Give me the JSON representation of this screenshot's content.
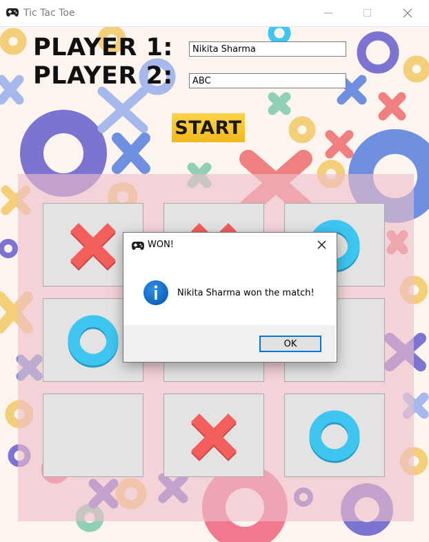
{
  "window": {
    "title": "Tic Tac Toe",
    "app_icon": "gamepad-icon",
    "controls": [
      "minimize-icon",
      "maximize-icon",
      "close-icon"
    ]
  },
  "players": {
    "player1_label": "PLAYER 1:",
    "player1_value": "Nikita Sharma",
    "player2_label": "PLAYER 2:",
    "player2_value": "ABC"
  },
  "start_label": "START",
  "board": {
    "cells": [
      "X",
      "X",
      "O",
      "O",
      "",
      "",
      "",
      "X",
      "O"
    ]
  },
  "dialog": {
    "title": "WON!",
    "icon": "info-icon",
    "message": "Nikita Sharma won the match!",
    "ok_label": "OK"
  },
  "colors": {
    "x_mark": "#f25f5c",
    "o_mark": "#3ec6f0",
    "start_button": "#f5c12a",
    "board_overlay": "#eebeca",
    "dialog_accent": "#0078d7"
  }
}
